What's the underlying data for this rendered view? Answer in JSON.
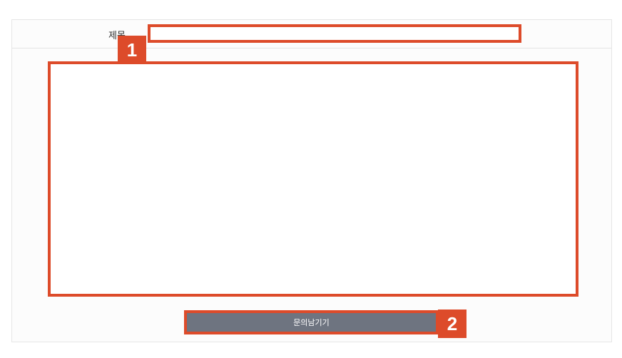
{
  "form": {
    "title_label": "제목",
    "title_value": "",
    "content_value": "",
    "submit_label": "문의남기기"
  },
  "annotations": {
    "badge_1": "1",
    "badge_2": "2"
  },
  "colors": {
    "highlight": "#dd4b2a",
    "button_bg": "#6e7480"
  }
}
